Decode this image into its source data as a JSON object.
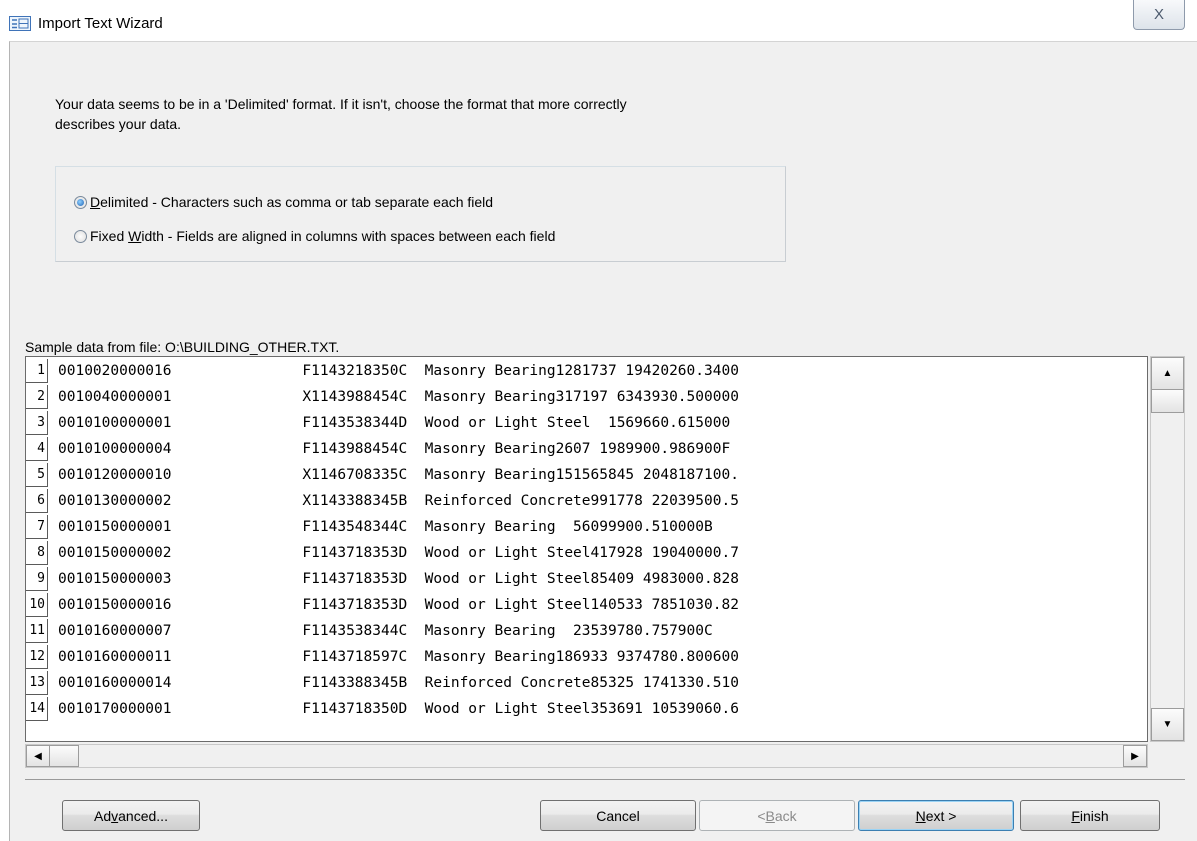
{
  "window": {
    "title": "Import Text Wizard",
    "close_glyph": "X",
    "icon": "form-icon"
  },
  "intro": {
    "line1": "Your data seems to be in a 'Delimited' format. If it isn't, choose the format that more correctly",
    "line2": "describes your data."
  },
  "format_options": [
    {
      "prefix": "",
      "accel": "D",
      "rest": "elimited - Characters such as comma or tab separate each field",
      "checked": true
    },
    {
      "prefix": "Fixed ",
      "accel": "W",
      "rest": "idth - Fields are aligned in columns with spaces between each field",
      "checked": false
    }
  ],
  "sample": {
    "label": "Sample data from file: O:\\BUILDING_OTHER.TXT.",
    "rows": [
      {
        "num": "1",
        "text": "0010020000016               F1143218350C  Masonry Bearing1281737 19420260.3400"
      },
      {
        "num": "2",
        "text": "0010040000001               X1143988454C  Masonry Bearing317197 6343930.500000"
      },
      {
        "num": "3",
        "text": "0010100000001               F1143538344D  Wood or Light Steel  1569660.615000"
      },
      {
        "num": "4",
        "text": "0010100000004               F1143988454C  Masonry Bearing2607 1989900.986900F"
      },
      {
        "num": "5",
        "text": "0010120000010               X1146708335C  Masonry Bearing151565845 2048187100."
      },
      {
        "num": "6",
        "text": "0010130000002               X1143388345B  Reinforced Concrete991778 22039500.5"
      },
      {
        "num": "7",
        "text": "0010150000001               F1143548344C  Masonry Bearing  56099900.510000B"
      },
      {
        "num": "8",
        "text": "0010150000002               F1143718353D  Wood or Light Steel417928 19040000.7"
      },
      {
        "num": "9",
        "text": "0010150000003               F1143718353D  Wood or Light Steel85409 4983000.828"
      },
      {
        "num": "10",
        "text": "0010150000016               F1143718353D  Wood or Light Steel140533 7851030.82"
      },
      {
        "num": "11",
        "text": "0010160000007               F1143538344C  Masonry Bearing  23539780.757900C"
      },
      {
        "num": "12",
        "text": "0010160000011               F1143718597C  Masonry Bearing186933 9374780.800600"
      },
      {
        "num": "13",
        "text": "0010160000014               F1143388345B  Reinforced Concrete85325 1741330.510"
      },
      {
        "num": "14",
        "text": "0010170000001               F1143718350D  Wood or Light Steel353691 10539060.6"
      }
    ]
  },
  "buttons": {
    "advanced": {
      "pre": "Ad",
      "accel": "v",
      "post": "anced..."
    },
    "cancel": {
      "label": "Cancel"
    },
    "back": {
      "pre": "< ",
      "accel": "B",
      "post": "ack",
      "enabled": false
    },
    "next": {
      "pre": "",
      "accel": "N",
      "post": "ext >"
    },
    "finish": {
      "pre": "",
      "accel": "F",
      "post": "inish"
    }
  },
  "colors": {
    "dialog_bg": "#f0f0f0",
    "default_button_border": "#3c7fb1"
  }
}
